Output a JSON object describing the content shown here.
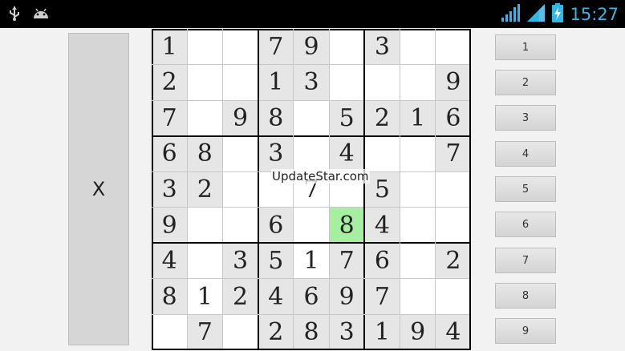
{
  "status_bar": {
    "time": "15:27",
    "icons": [
      "usb-icon",
      "android-debug-icon",
      "wifi-signal-icon",
      "cell-signal-icon",
      "battery-charging-icon"
    ],
    "accent_color": "#33b5e5"
  },
  "clear_button": {
    "label": "X"
  },
  "watermark": "UpdateStar.com",
  "selected_cell": {
    "row": 5,
    "col": 5,
    "color": "#a5f0a0"
  },
  "board": [
    [
      "1",
      "",
      "",
      "7",
      "9",
      "",
      "3",
      "",
      ""
    ],
    [
      "2",
      "",
      "",
      "1",
      "3",
      "",
      "",
      "",
      "9"
    ],
    [
      "7",
      "",
      "9",
      "8",
      "",
      "5",
      "2",
      "1",
      "6"
    ],
    [
      "6",
      "8",
      "",
      "3",
      "",
      "4",
      "",
      "",
      "7"
    ],
    [
      "3",
      "2",
      "",
      "",
      "7",
      "",
      "5",
      "",
      ""
    ],
    [
      "9",
      "",
      "",
      "6",
      "",
      "8",
      "4",
      "",
      ""
    ],
    [
      "4",
      "",
      "3",
      "5",
      "1",
      "7",
      "6",
      "",
      "2"
    ],
    [
      "8",
      "1",
      "2",
      "4",
      "6",
      "9",
      "7",
      "",
      ""
    ],
    [
      "",
      "7",
      "",
      "2",
      "8",
      "3",
      "1",
      "9",
      "4"
    ]
  ],
  "given_mask": [
    [
      1,
      0,
      0,
      1,
      1,
      0,
      1,
      0,
      0
    ],
    [
      1,
      0,
      0,
      1,
      1,
      0,
      0,
      0,
      1
    ],
    [
      1,
      0,
      1,
      1,
      0,
      1,
      1,
      1,
      1
    ],
    [
      1,
      1,
      0,
      1,
      0,
      1,
      0,
      0,
      1
    ],
    [
      1,
      1,
      0,
      0,
      0,
      0,
      1,
      0,
      0
    ],
    [
      1,
      0,
      0,
      1,
      0,
      1,
      1,
      0,
      0
    ],
    [
      1,
      0,
      1,
      1,
      0,
      1,
      1,
      0,
      1
    ],
    [
      1,
      0,
      1,
      1,
      1,
      1,
      1,
      0,
      0
    ],
    [
      0,
      1,
      0,
      1,
      1,
      1,
      1,
      1,
      1
    ]
  ],
  "number_buttons": [
    "1",
    "2",
    "3",
    "4",
    "5",
    "6",
    "7",
    "8",
    "9"
  ]
}
